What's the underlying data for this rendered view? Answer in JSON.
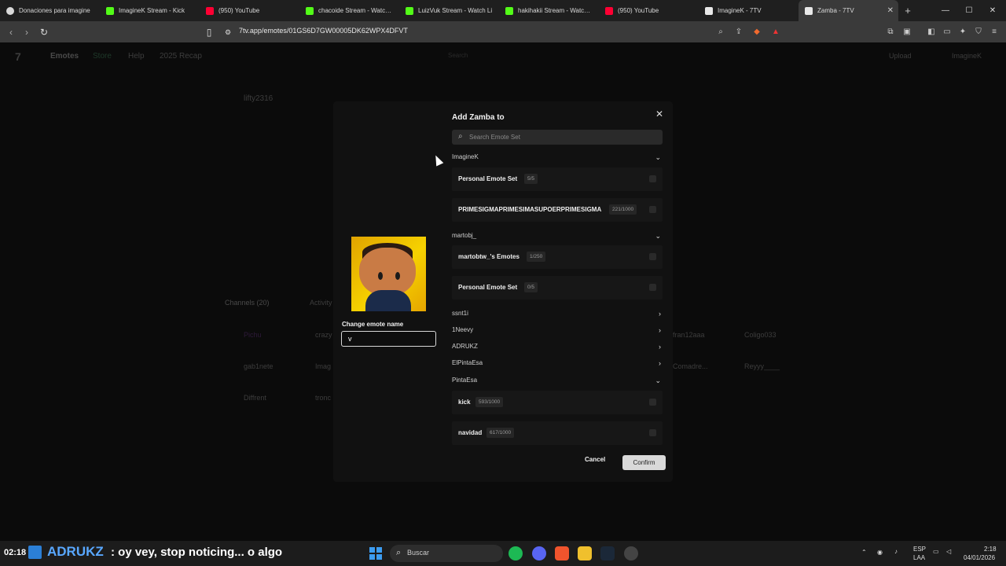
{
  "browser": {
    "tabs": [
      {
        "label": "Donaciones para imagine",
        "color": "#d9d9d9",
        "active": false
      },
      {
        "label": "ImagineK Stream - Kick",
        "color": "#53fc18",
        "active": false
      },
      {
        "label": "(950) YouTube",
        "color": "#ff0033",
        "active": false
      },
      {
        "label": "chacoide Stream - Watch L",
        "color": "#53fc18",
        "active": false
      },
      {
        "label": "LuizVuk Stream - Watch Li",
        "color": "#53fc18",
        "active": false
      },
      {
        "label": "hakihakii Stream - Watch L",
        "color": "#53fc18",
        "active": false
      },
      {
        "label": "(950) YouTube",
        "color": "#ff0033",
        "active": false
      },
      {
        "label": "ImagineK - 7TV",
        "color": "#e8e8e8",
        "active": false
      },
      {
        "label": "Zamba - 7TV",
        "color": "#e8e8e8",
        "active": true
      }
    ],
    "new_tab": "+",
    "url": "7tv.app/emotes/01GS6D7GW00005DK62WPX4DFVT",
    "window_controls": {
      "minimize": "—",
      "maximize": "☐",
      "close": "✕"
    }
  },
  "site": {
    "nav": [
      "Emotes",
      "Store",
      "Help",
      "2025 Recap"
    ],
    "search_placeholder": "Search",
    "upload": "Upload",
    "account": "ImagineK",
    "uploader": "lifty2316",
    "channels_tab": "Channels (20)",
    "activity_tab": "Activity",
    "channel_names": [
      "Pichu",
      "crazy",
      "fran12aaa",
      "Coligo033",
      "gab1nete",
      "Imag",
      "Comadre...",
      "Reyyy____",
      "Diffrent",
      "tronc"
    ]
  },
  "dialog": {
    "title": "Add Zamba to",
    "close": "✕",
    "search_placeholder": "Search Emote Set",
    "change_name_label": "Change emote name",
    "name_value": "v",
    "groups": [
      {
        "name": "ImagineK",
        "expanded": true,
        "sets": [
          {
            "name": "Personal Emote Set",
            "count": "5/5"
          },
          {
            "name": "PRIMESIGMAPRIMESIMASUPOERPRIMESIGMA",
            "count": "221/1000"
          }
        ]
      },
      {
        "name": "martobj_",
        "expanded": true,
        "sets": [
          {
            "name": "martobtw_'s Emotes",
            "count": "1/250"
          },
          {
            "name": "Personal Emote Set",
            "count": "0/5"
          }
        ]
      },
      {
        "name": "ssnt1i",
        "expanded": false,
        "sets": []
      },
      {
        "name": "1Neevy",
        "expanded": false,
        "sets": []
      },
      {
        "name": "ADRUKZ",
        "expanded": false,
        "sets": []
      },
      {
        "name": "ElPintaEsa",
        "expanded": false,
        "sets": []
      },
      {
        "name": "PintaEsa",
        "expanded": true,
        "sets": [
          {
            "name": "kick",
            "count": "593/1000"
          },
          {
            "name": "navidad",
            "count": "617/1000"
          }
        ]
      }
    ],
    "cancel": "Cancel",
    "confirm": "Confirm"
  },
  "taskbar": {
    "time_left": "02:18",
    "ticker_user": "ADRUKZ",
    "ticker_message": ": oy vey, stop noticing... o algo",
    "search_label": "Buscar",
    "lang": "ESP",
    "lang_sub": "LAA",
    "time": "2:18",
    "date": "04/01/2026"
  }
}
